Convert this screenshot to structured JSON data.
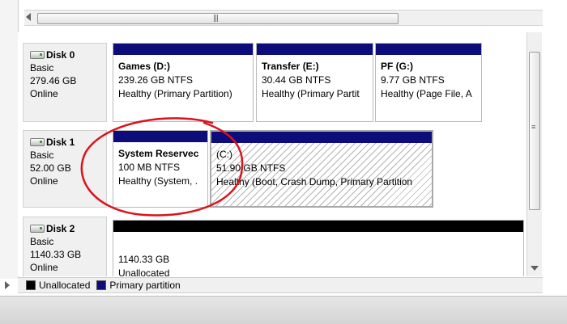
{
  "colors": {
    "primary_partition": "#0c0c7a",
    "unallocated": "#000000",
    "annotation": "#d9141c"
  },
  "disks": [
    {
      "name": "Disk 0",
      "type": "Basic",
      "size": "279.46 GB",
      "status": "Online",
      "partitions": [
        {
          "title": "Games  (D:)",
          "size_fs": "239.26 GB NTFS",
          "status": "Healthy (Primary Partition)"
        },
        {
          "title": "Transfer  (E:)",
          "size_fs": "30.44 GB NTFS",
          "status": "Healthy (Primary Partit"
        },
        {
          "title": "PF  (G:)",
          "size_fs": "9.77 GB NTFS",
          "status": "Healthy (Page File, A"
        }
      ]
    },
    {
      "name": "Disk 1",
      "type": "Basic",
      "size": "52.00 GB",
      "status": "Online",
      "partitions": [
        {
          "title": "System Reservec",
          "size_fs": "100 MB NTFS",
          "status": "Healthy (System, ."
        },
        {
          "title": "(C:)",
          "size_fs": "51.90 GB NTFS",
          "status": "Healthy (Boot, Crash Dump, Primary Partition"
        }
      ]
    },
    {
      "name": "Disk 2",
      "type": "Basic",
      "size": "1140.33 GB",
      "status": "Online",
      "partitions": [
        {
          "title": "",
          "size_fs": "1140.33 GB",
          "status": "Unallocated"
        }
      ]
    }
  ],
  "legend": {
    "unallocated": "Unallocated",
    "primary": "Primary partition"
  }
}
